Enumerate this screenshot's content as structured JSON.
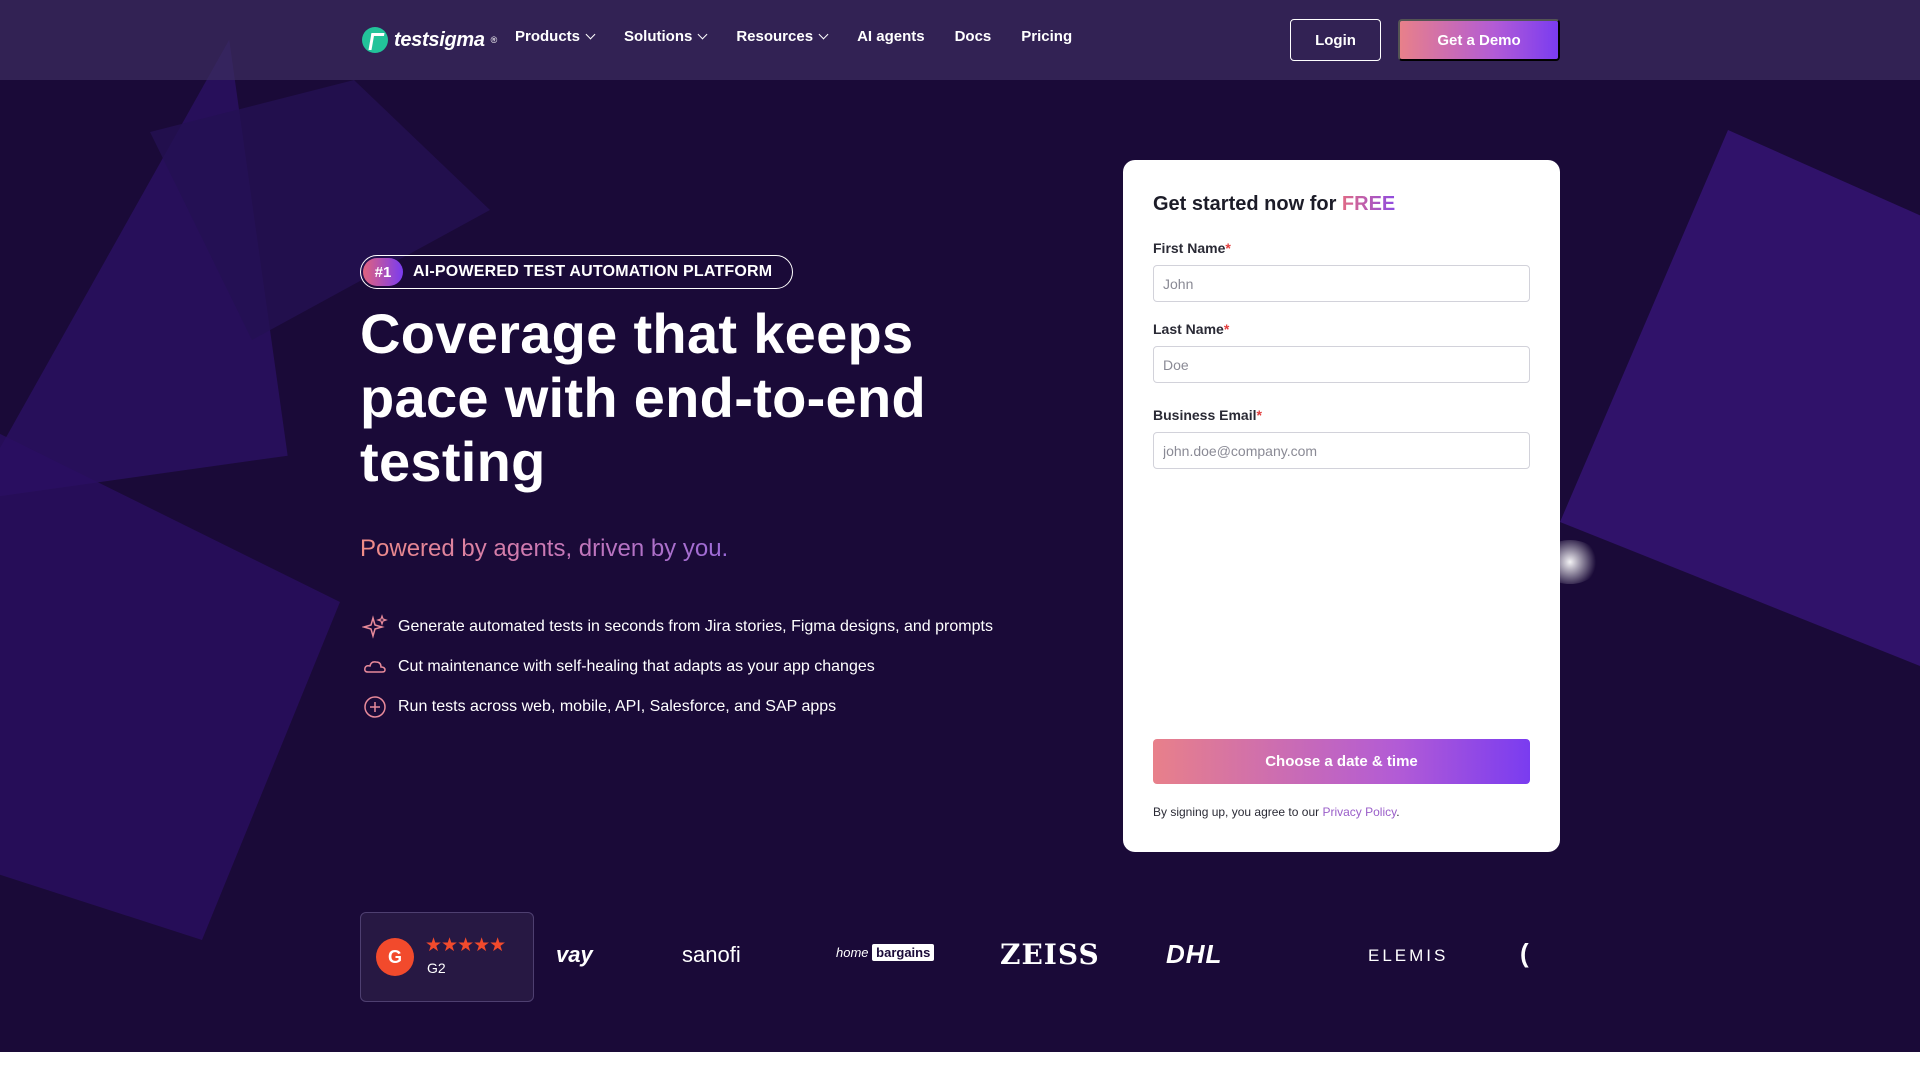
{
  "nav": {
    "logo_text": "testsigma",
    "logo_reg": "®",
    "links": [
      {
        "label": "Products",
        "dropdown": true
      },
      {
        "label": "Solutions",
        "dropdown": true
      },
      {
        "label": "Resources",
        "dropdown": true
      },
      {
        "label": "AI agents",
        "dropdown": false
      },
      {
        "label": "Docs",
        "dropdown": false
      },
      {
        "label": "Pricing",
        "dropdown": false
      }
    ],
    "login_label": "Login",
    "demo_label": "Get a Demo"
  },
  "hero": {
    "badge_num": "#1",
    "badge_text": "AI-POWERED TEST AUTOMATION PLATFORM",
    "headline": "Coverage that keeps pace with end-to-end testing",
    "subhead": "Powered by agents, driven by you.",
    "features": [
      {
        "icon": "sparkle-icon",
        "text": "Generate automated tests in seconds from Jira stories, Figma designs, and prompts"
      },
      {
        "icon": "cloud-icon",
        "text": "Cut maintenance with self-healing that adapts as your app changes"
      },
      {
        "icon": "plus-circle-icon",
        "text": "Run tests across web, mobile, API, Salesforce, and SAP apps"
      }
    ]
  },
  "form": {
    "title": "Get started now for ",
    "title_highlight": "FREE",
    "first_name_label": "First Name",
    "first_name_placeholder": "John",
    "last_name_label": "Last Name",
    "last_name_placeholder": "Doe",
    "email_label": "Business Email",
    "email_placeholder": "john.doe@company.com",
    "required_mark": "*",
    "cta_label": "Choose a date & time",
    "policy_text": "By signing up, you agree to our ",
    "policy_link": "Privacy Policy",
    "policy_end": "."
  },
  "rating": {
    "badge": "G",
    "stars": "★★★★★",
    "rating_value": 4.5,
    "label": "G2"
  },
  "clients": {
    "way": "vay",
    "sanofi": "sanofi",
    "home": "home",
    "bargains": "bargains",
    "zeiss": "ZEISS",
    "dhl": "DHL",
    "elemis": "ELEMIS",
    "cut": "("
  },
  "colors": {
    "hero_bg": "#1a0a38",
    "accent_start": "#e8808a",
    "accent_end": "#7a3cf0",
    "required": "#e23d3d",
    "g2": "#f24a2c"
  }
}
